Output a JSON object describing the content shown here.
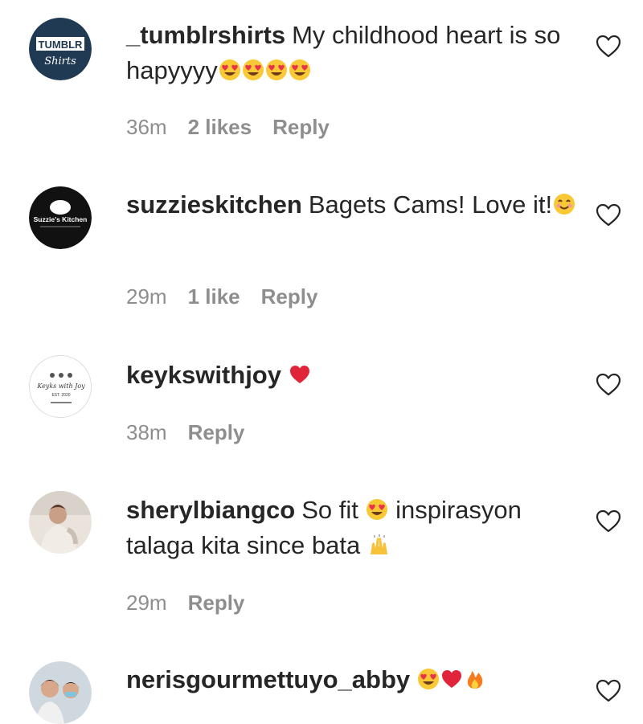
{
  "comments": [
    {
      "avatar_text_top": "TUMBLR",
      "avatar_text_bottom": "Shirts",
      "username": "_tumblrshirts",
      "text": "My childhood heart is so hapyyyy",
      "emojis": [
        "heart-eyes-emoji",
        "heart-eyes-emoji",
        "heart-eyes-emoji",
        "heart-eyes-emoji"
      ],
      "time": "36m",
      "likes": "2 likes",
      "reply": "Reply"
    },
    {
      "avatar_text": "Suzzie's Kitchen",
      "username": "suzzieskitchen",
      "text": "Bagets Cams! Love it!",
      "emojis": [
        "smiling-emoji"
      ],
      "time": "29m",
      "likes": "1 like",
      "reply": "Reply"
    },
    {
      "avatar_text_top": "Keyks with Joy",
      "avatar_text_bottom": "EST. 2020",
      "username": "keykswithjoy",
      "text": "",
      "emojis": [
        "red-heart-emoji"
      ],
      "time": "38m",
      "reply": "Reply"
    },
    {
      "username": "sherylbiangco",
      "text_part1": "So fit",
      "text_part2": "inspirasyon talaga kita since bata",
      "emojis": [
        "heart-eyes-emoji",
        "raising-hands-emoji"
      ],
      "time": "29m",
      "reply": "Reply"
    },
    {
      "username": "nerisgourmettuyo_abby",
      "text": "",
      "emojis": [
        "heart-eyes-emoji",
        "red-heart-emoji",
        "fire-emoji"
      ]
    }
  ],
  "colors": {
    "text": "#262626",
    "meta": "#8e8e8e",
    "heart_outline": "#262626"
  }
}
